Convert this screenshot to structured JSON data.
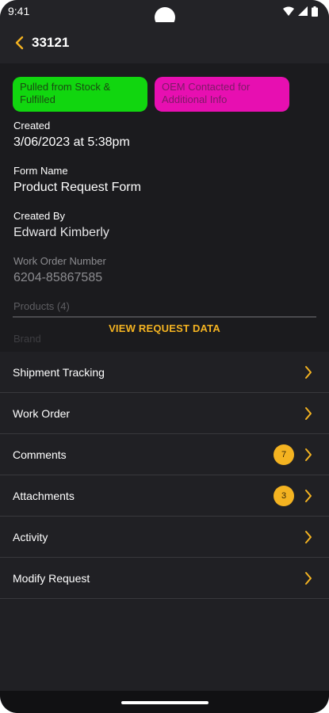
{
  "status_bar": {
    "time": "9:41"
  },
  "app_bar": {
    "title": "33121"
  },
  "tags": [
    {
      "label": "Pulled from Stock & Fulfilled",
      "color": "#11d60f"
    },
    {
      "label": "OEM Contacted for Additional Info",
      "color": "#e70fb1"
    }
  ],
  "fields": {
    "created": {
      "label": "Created",
      "value": "3/06/2023 at 5:38pm"
    },
    "form_name": {
      "label": "Form Name",
      "value": "Product Request Form"
    },
    "created_by": {
      "label": "Created By",
      "value": "Edward Kimberly"
    },
    "work_order_number": {
      "label": "Work Order Number",
      "value": "6204-85867585"
    },
    "products": {
      "label": "Products (4)"
    },
    "brand": {
      "label": "Brand"
    }
  },
  "view_request_label": "VIEW REQUEST DATA",
  "menu": [
    {
      "label": "Shipment Tracking"
    },
    {
      "label": "Work Order"
    },
    {
      "label": "Comments",
      "badge": "7"
    },
    {
      "label": "Attachments",
      "badge": "3"
    },
    {
      "label": "Activity"
    },
    {
      "label": "Modify Request"
    }
  ],
  "colors": {
    "accent": "#f4b321",
    "background": "#202024"
  }
}
